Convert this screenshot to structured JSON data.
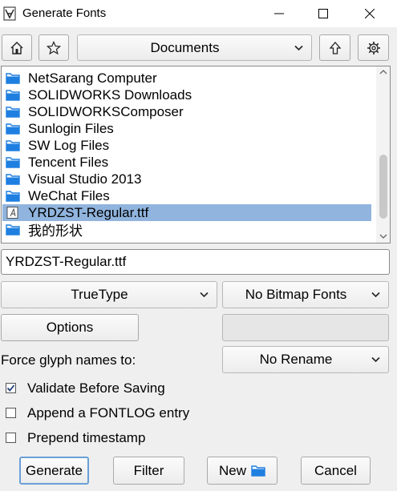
{
  "window": {
    "title": "Generate Fonts"
  },
  "toolbar": {
    "location": "Documents"
  },
  "files": [
    {
      "name": "NetSarang Computer",
      "type": "folder"
    },
    {
      "name": "SOLIDWORKS Downloads",
      "type": "folder"
    },
    {
      "name": "SOLIDWORKSComposer",
      "type": "folder"
    },
    {
      "name": "Sunlogin Files",
      "type": "folder"
    },
    {
      "name": "SW Log Files",
      "type": "folder"
    },
    {
      "name": "Tencent Files",
      "type": "folder"
    },
    {
      "name": "Visual Studio 2013",
      "type": "folder"
    },
    {
      "name": "WeChat Files",
      "type": "folder"
    },
    {
      "name": "YRDZST-Regular.ttf",
      "type": "font",
      "selected": true
    },
    {
      "name": "我的形状",
      "type": "folder"
    }
  ],
  "filename": "YRDZST-Regular.ttf",
  "format": {
    "outline": "TrueType",
    "bitmap": "No Bitmap Fonts"
  },
  "options_label": "Options",
  "glyph": {
    "label": "Force glyph names to:",
    "value": "No Rename"
  },
  "checks": [
    {
      "label": "Validate Before Saving",
      "checked": true
    },
    {
      "label": "Append a FONTLOG entry",
      "checked": false
    },
    {
      "label": "Prepend timestamp",
      "checked": false
    }
  ],
  "buttons": {
    "generate": "Generate",
    "filter": "Filter",
    "new": "New",
    "cancel": "Cancel"
  },
  "icons": {
    "home": "home-icon",
    "bookmark": "star-icon",
    "up": "arrow-up-icon",
    "settings": "gear-icon",
    "folder": "folder-icon",
    "font_file": "font-file-icon"
  },
  "colors": {
    "selection": "#90b4dd",
    "folder": "#1e7fe0",
    "background": "#efefef"
  }
}
